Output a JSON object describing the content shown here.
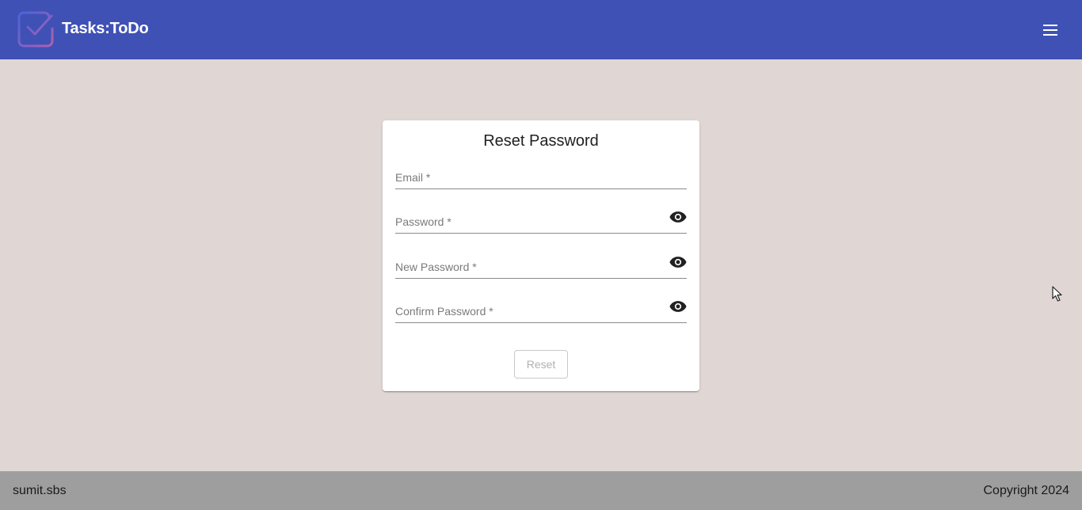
{
  "header": {
    "brand": "Tasks:ToDo",
    "logo_icon": "checkbox-logo-icon",
    "menu_icon": "hamburger-menu-icon",
    "color": "#3f51b5"
  },
  "form": {
    "title": "Reset Password",
    "fields": [
      {
        "label": "Email *",
        "value": "",
        "type": "email",
        "has_visibility_toggle": false
      },
      {
        "label": "Password *",
        "value": "",
        "type": "password",
        "has_visibility_toggle": true
      },
      {
        "label": "New Password *",
        "value": "",
        "type": "password",
        "has_visibility_toggle": true
      },
      {
        "label": "Confirm Password *",
        "value": "",
        "type": "password",
        "has_visibility_toggle": true
      }
    ],
    "visibility_icon": "eye-icon",
    "submit_label": "Reset",
    "submit_disabled": true
  },
  "footer": {
    "left": "sumit.sbs",
    "right": "Copyright 2024"
  }
}
